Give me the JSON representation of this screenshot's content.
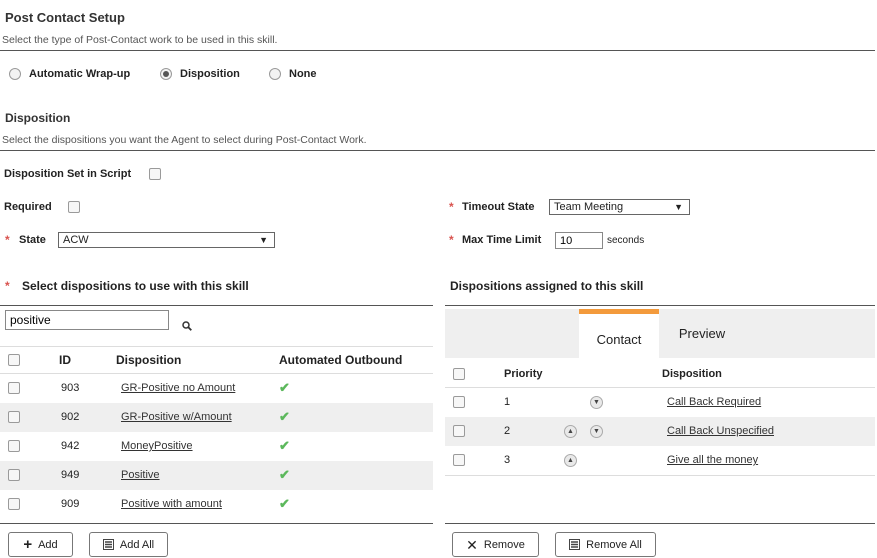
{
  "post_contact": {
    "title": "Post Contact Setup",
    "description": "Select the type of Post-Contact work to be used in this skill.",
    "options": [
      {
        "label": "Automatic Wrap-up",
        "selected": false
      },
      {
        "label": "Disposition",
        "selected": true
      },
      {
        "label": "None",
        "selected": false
      }
    ]
  },
  "disposition": {
    "title": "Disposition",
    "description": "Select the dispositions you want the Agent to select during Post-Contact Work.",
    "set_in_script_label": "Disposition Set in Script",
    "required_label": "Required",
    "state_label": "State",
    "state_value": "ACW",
    "timeout_state_label": "Timeout State",
    "timeout_state_value": "Team Meeting",
    "max_time_label": "Max Time Limit",
    "max_time_value": "10",
    "max_time_unit": "seconds",
    "required_marker": "*"
  },
  "left_panel": {
    "title": "Select dispositions to use with this skill",
    "search_value": "positive",
    "columns": [
      "ID",
      "Disposition",
      "Automated Outbound"
    ],
    "rows": [
      {
        "id": "903",
        "name": "GR-Positive no Amount",
        "outbound": true
      },
      {
        "id": "902",
        "name": "GR-Positive w/Amount",
        "outbound": true
      },
      {
        "id": "942",
        "name": "MoneyPositive",
        "outbound": true
      },
      {
        "id": "949",
        "name": "Positive",
        "outbound": true
      },
      {
        "id": "909",
        "name": "Positive with amount",
        "outbound": true
      }
    ],
    "add_label": "Add",
    "add_all_label": "Add All"
  },
  "right_panel": {
    "title": "Dispositions assigned to this skill",
    "tabs": [
      "Contact",
      "Preview"
    ],
    "active_tab": "Contact",
    "columns": [
      "Priority",
      "Disposition"
    ],
    "rows": [
      {
        "priority": "1",
        "name": "Call Back Required",
        "up": false,
        "down": true
      },
      {
        "priority": "2",
        "name": "Call Back Unspecified",
        "up": true,
        "down": true
      },
      {
        "priority": "3",
        "name": "Give all the money",
        "up": true,
        "down": false
      }
    ],
    "remove_label": "Remove",
    "remove_all_label": "Remove All"
  },
  "colors": {
    "accent": "#f39a3c",
    "required": "#d9534f",
    "check": "#5cb85c"
  }
}
